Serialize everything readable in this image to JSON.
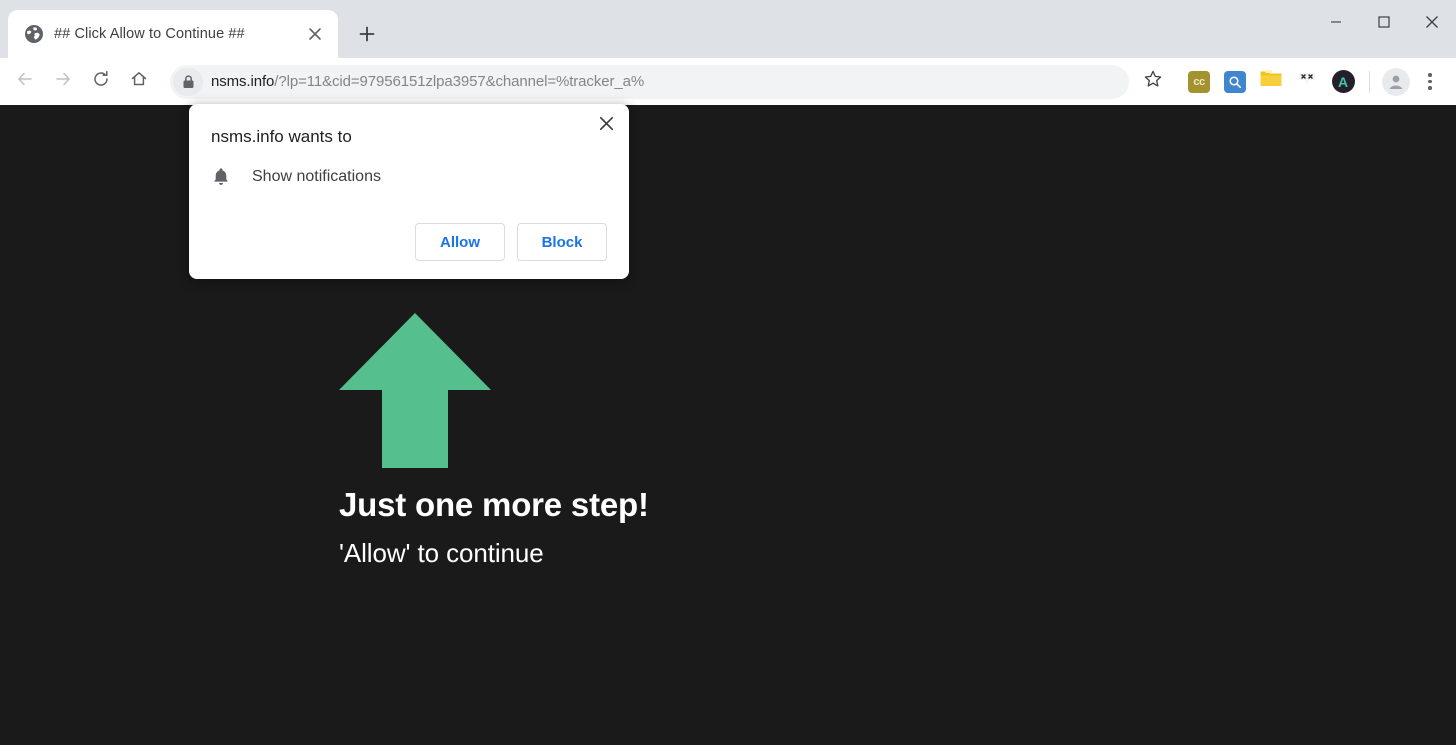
{
  "window": {
    "controls": {
      "minimize": "minimize-button",
      "maximize": "maximize-button",
      "close": "close-button"
    }
  },
  "tabs": [
    {
      "title": "## Click Allow to Continue ##",
      "favicon": "globe-icon",
      "active": true
    }
  ],
  "new_tab_label": "+",
  "toolbar": {
    "back_icon": "back-arrow-icon",
    "forward_icon": "forward-arrow-icon",
    "reload_icon": "reload-icon",
    "home_icon": "home-icon",
    "lock_icon": "lock-icon",
    "url": {
      "host": "nsms.info",
      "path": "/?lp=11&cid=97956151zlpa3957&channel=%tracker_a%",
      "full": "nsms.info/?lp=11&cid=97956151zlpa3957&channel=%tracker_a%"
    },
    "bookmark_icon": "star-icon",
    "extensions": [
      {
        "name": "cc-extension-icon",
        "label": "cc",
        "color": "#a39330"
      },
      {
        "name": "search-extension-icon",
        "label": "",
        "color": "#4285cf"
      },
      {
        "name": "folder-extension-icon",
        "label": "",
        "color": "#f2c029"
      },
      {
        "name": "face-extension-icon",
        "label": "",
        "color": "#ffffff"
      },
      {
        "name": "adblock-extension-icon",
        "label": "A",
        "color": "#3ec8a5"
      }
    ],
    "profile_icon": "profile-avatar-icon",
    "menu_icon": "three-dot-menu-icon"
  },
  "permission_dialog": {
    "title": "nsms.info wants to",
    "permission_label": "Show notifications",
    "permission_icon": "bell-icon",
    "allow_label": "Allow",
    "block_label": "Block",
    "close_icon": "close-icon",
    "accent_color": "#1a73e8"
  },
  "page": {
    "background_color": "#1a1a1a",
    "arrow_icon": "green-up-arrow-icon",
    "arrow_color": "#55c08e",
    "heading": "Just one more step!",
    "subtext": "'Allow' to continue",
    "text_color": "#ffffff"
  }
}
